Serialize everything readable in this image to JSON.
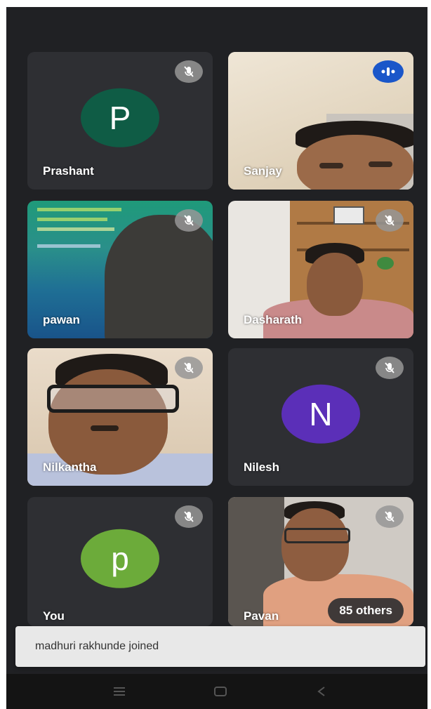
{
  "participants": [
    {
      "name": "Prashant",
      "avatar_letter": "P",
      "avatar_color": "#0f5c45",
      "muted": true
    },
    {
      "name": "Sanjay",
      "speaking": true
    },
    {
      "name": "pawan",
      "muted": true
    },
    {
      "name": "Dasharath",
      "muted": true
    },
    {
      "name": "Nilkantha",
      "muted": true
    },
    {
      "name": "Nilesh",
      "avatar_letter": "N",
      "avatar_color": "#5b2fb8",
      "muted": true
    },
    {
      "name": "You",
      "avatar_letter": "p",
      "avatar_color": "#6cab3a",
      "muted": true
    },
    {
      "name": "Pavan",
      "muted": true
    }
  ],
  "others_badge": "85 others",
  "toast": {
    "text": "madhuri rakhunde joined"
  },
  "colors": {
    "background": "#202124",
    "tile": "#2e2f33",
    "speaking": "#1a56c9"
  },
  "icons": {
    "mute": "mic-off-icon",
    "speaking": "speaking-icon",
    "nav": [
      "menu-icon",
      "home-icon",
      "back-icon"
    ]
  }
}
